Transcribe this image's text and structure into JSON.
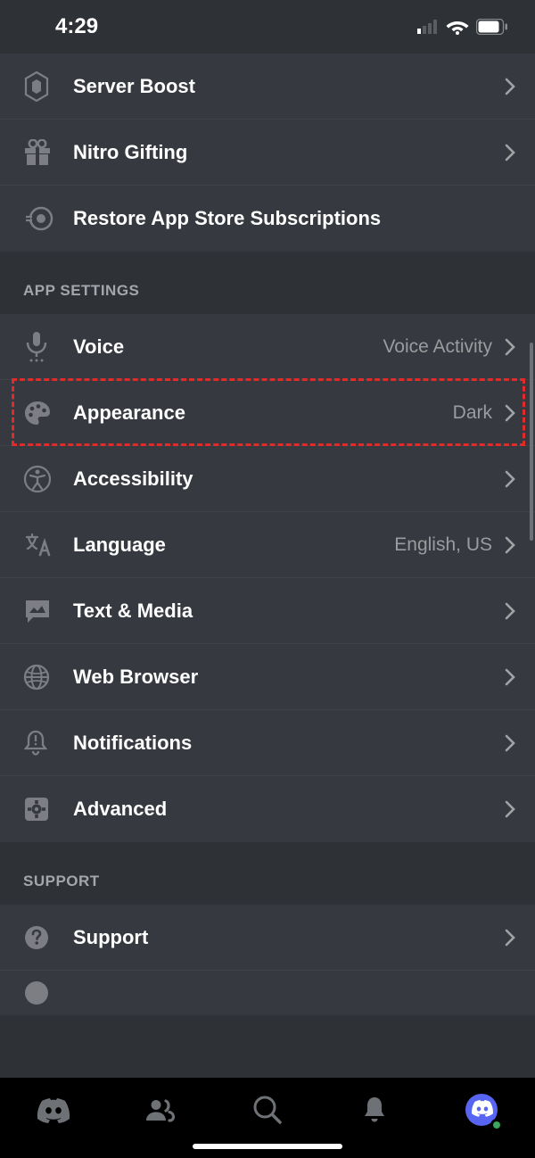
{
  "status_bar": {
    "time": "4:29"
  },
  "sections": [
    {
      "header": null,
      "items": [
        {
          "icon": "boost-icon",
          "label": "Server Boost",
          "value": null,
          "chevron": true
        },
        {
          "icon": "gift-icon",
          "label": "Nitro Gifting",
          "value": null,
          "chevron": true
        },
        {
          "icon": "restore-icon",
          "label": "Restore App Store Subscriptions",
          "value": null,
          "chevron": false
        }
      ]
    },
    {
      "header": "APP SETTINGS",
      "items": [
        {
          "icon": "mic-icon",
          "label": "Voice",
          "value": "Voice Activity",
          "chevron": true
        },
        {
          "icon": "palette-icon",
          "label": "Appearance",
          "value": "Dark",
          "chevron": true,
          "highlighted": true
        },
        {
          "icon": "accessibility-icon",
          "label": "Accessibility",
          "value": null,
          "chevron": true
        },
        {
          "icon": "language-icon",
          "label": "Language",
          "value": "English, US",
          "chevron": true
        },
        {
          "icon": "text-media-icon",
          "label": "Text & Media",
          "value": null,
          "chevron": true
        },
        {
          "icon": "browser-icon",
          "label": "Web Browser",
          "value": null,
          "chevron": true
        },
        {
          "icon": "notifications-icon",
          "label": "Notifications",
          "value": null,
          "chevron": true
        },
        {
          "icon": "advanced-icon",
          "label": "Advanced",
          "value": null,
          "chevron": true
        }
      ]
    },
    {
      "header": "SUPPORT",
      "items": [
        {
          "icon": "support-icon",
          "label": "Support",
          "value": null,
          "chevron": true
        }
      ]
    }
  ]
}
